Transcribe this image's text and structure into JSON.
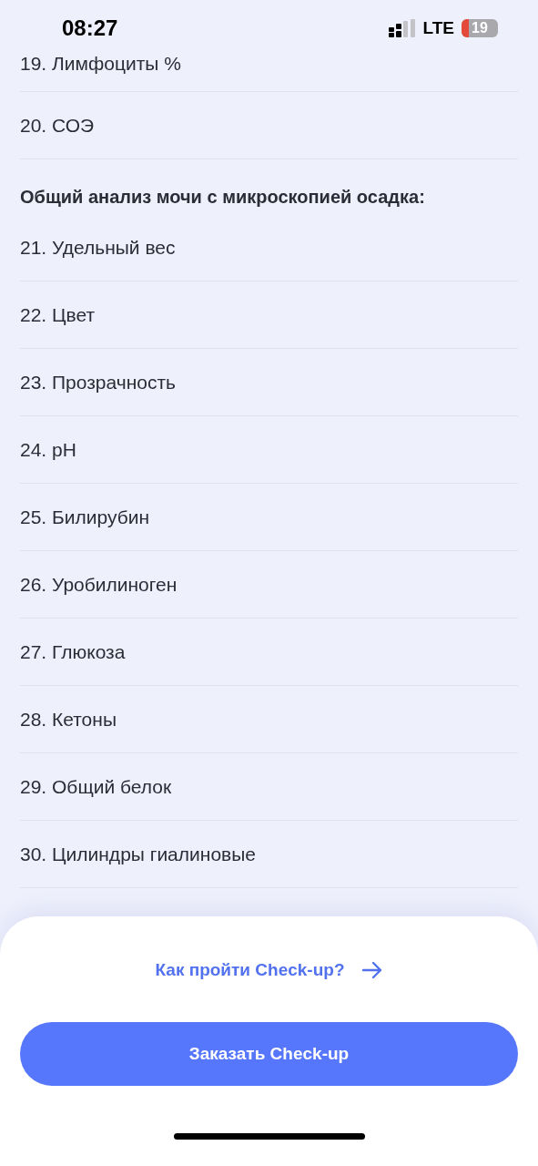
{
  "status_bar": {
    "time": "08:27",
    "network": "LTE",
    "battery": "19"
  },
  "list": [
    {
      "kind": "item",
      "label": "19. Лимфоциты %"
    },
    {
      "kind": "item",
      "label": "20. СОЭ"
    },
    {
      "kind": "heading",
      "label": "Общий анализ мочи с микроскопией осадка:"
    },
    {
      "kind": "item",
      "label": "21. Удельный вес"
    },
    {
      "kind": "item",
      "label": "22. Цвет"
    },
    {
      "kind": "item",
      "label": "23. Прозрачность"
    },
    {
      "kind": "item",
      "label": "24. pH"
    },
    {
      "kind": "item",
      "label": "25. Билирубин"
    },
    {
      "kind": "item",
      "label": "26. Уробилиноген"
    },
    {
      "kind": "item",
      "label": "27. Глюкоза"
    },
    {
      "kind": "item",
      "label": "28. Кетоны"
    },
    {
      "kind": "item",
      "label": "29. Общий белок"
    },
    {
      "kind": "item",
      "label": "30. Цилиндры гиалиновые"
    }
  ],
  "sheet": {
    "link": "Как пройти Check-up?",
    "button": "Заказать Check-up"
  }
}
